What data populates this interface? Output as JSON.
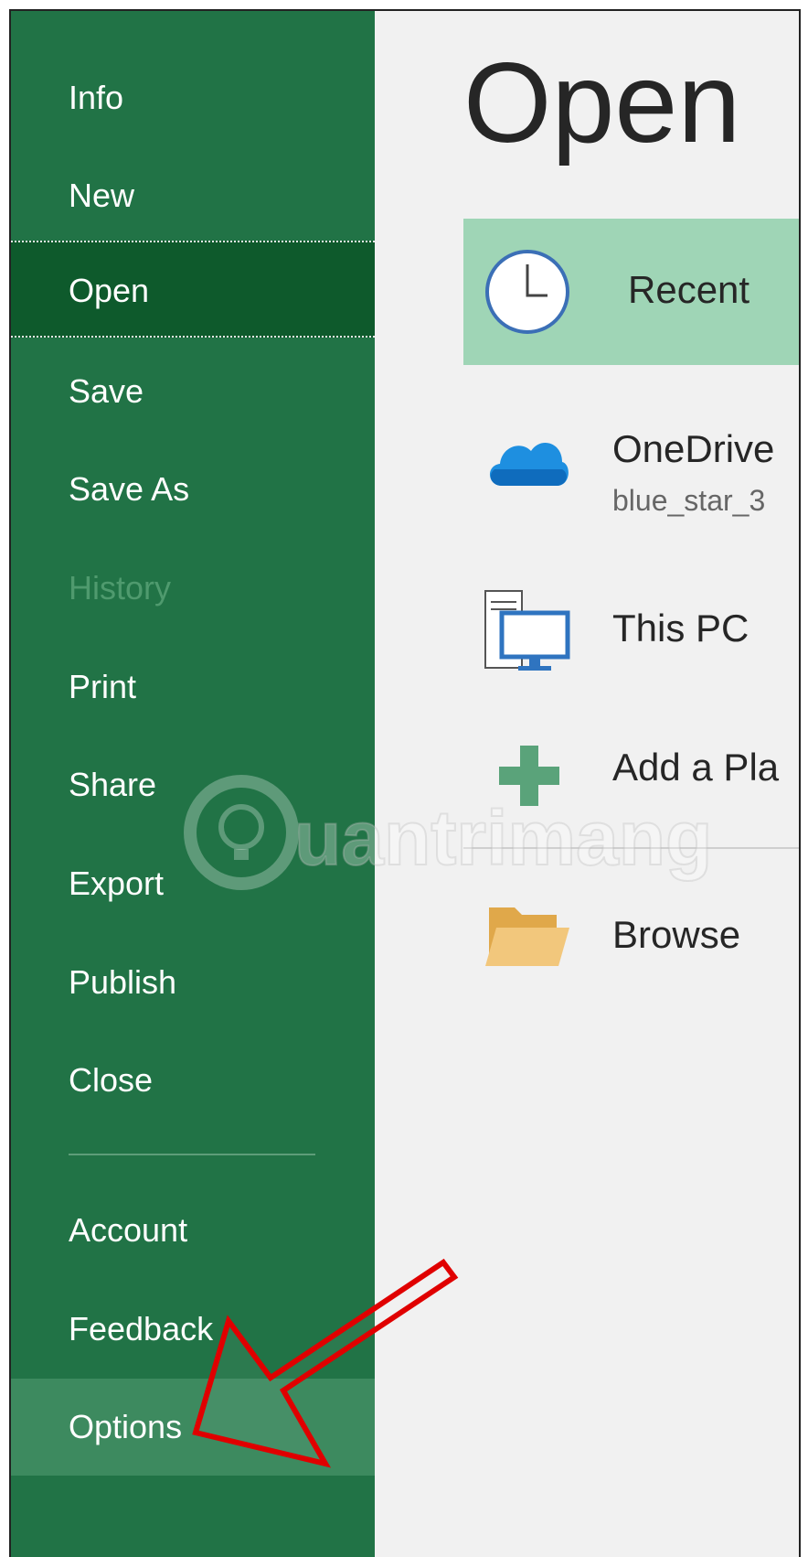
{
  "nav": {
    "items": [
      {
        "label": "Info"
      },
      {
        "label": "New"
      },
      {
        "label": "Open"
      },
      {
        "label": "Save"
      },
      {
        "label": "Save As"
      },
      {
        "label": "History"
      },
      {
        "label": "Print"
      },
      {
        "label": "Share"
      },
      {
        "label": "Export"
      },
      {
        "label": "Publish"
      },
      {
        "label": "Close"
      },
      {
        "label": "Account"
      },
      {
        "label": "Feedback"
      },
      {
        "label": "Options"
      }
    ]
  },
  "main": {
    "title": "Open",
    "locations": [
      {
        "label": "Recent",
        "icon": "clock-icon"
      },
      {
        "label": "OneDrive",
        "sub": "blue_star_3",
        "icon": "cloud-icon"
      },
      {
        "label": "This PC",
        "icon": "computer-icon"
      },
      {
        "label": "Add a Pla",
        "icon": "plus-icon"
      },
      {
        "label": "Browse",
        "icon": "folder-icon"
      }
    ]
  },
  "watermark": {
    "text": "uantrimang"
  },
  "colors": {
    "sidebar": "#217346",
    "active": "#0e5a2c",
    "selected": "#9fd5b6",
    "annotation": "#e00000"
  }
}
